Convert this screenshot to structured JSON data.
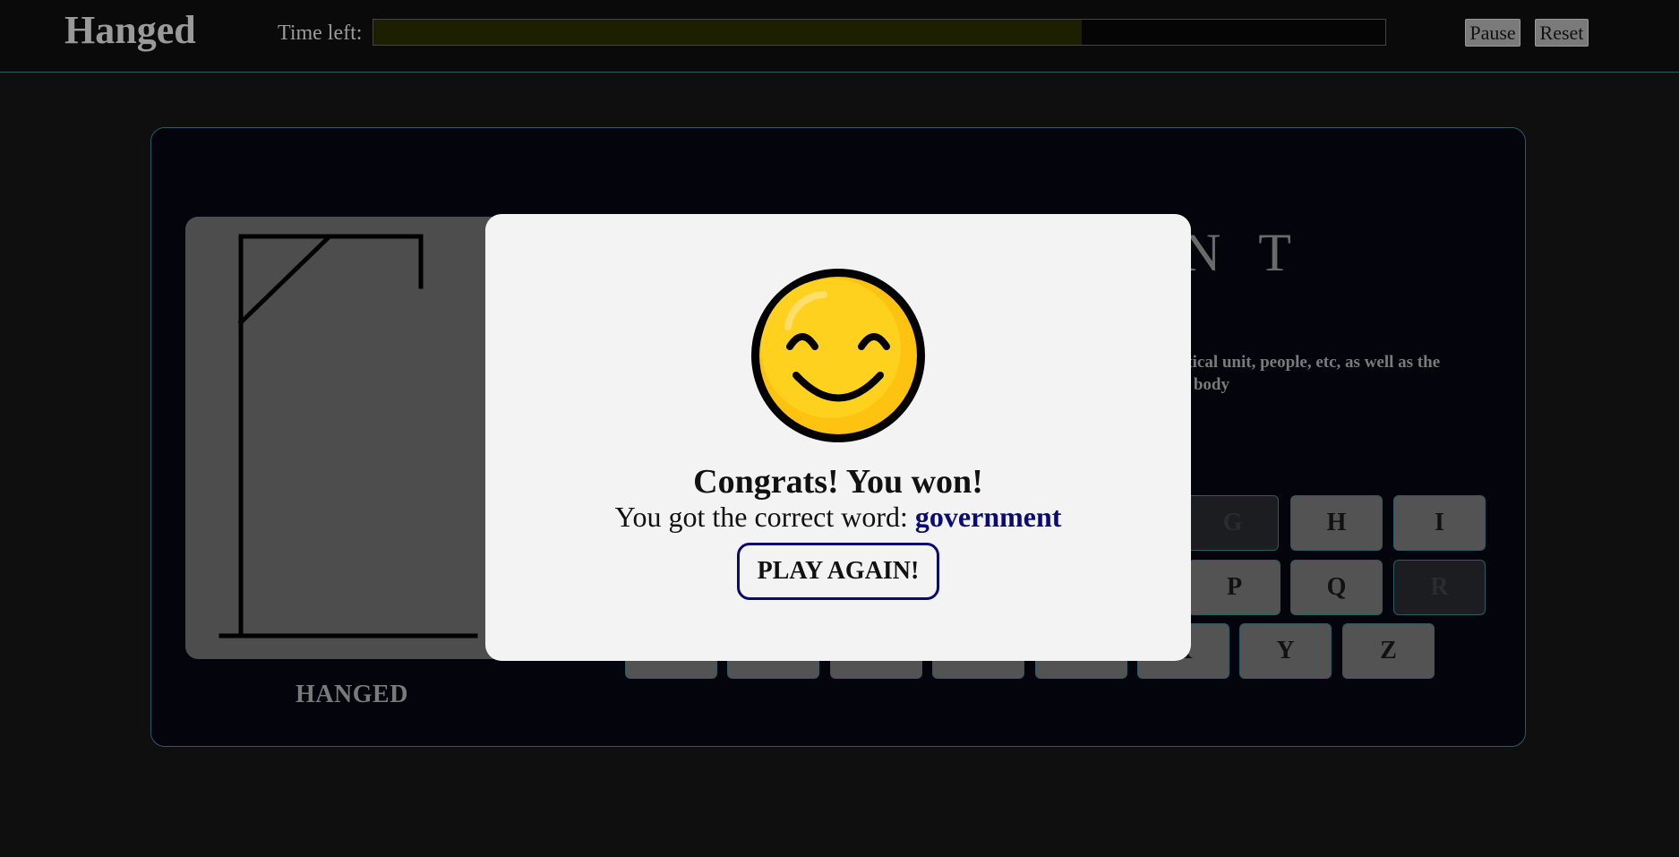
{
  "header": {
    "brand": "Hanged",
    "time_label": "Time left:",
    "time_left_fraction": 0.7,
    "pause_label": "Pause",
    "reset_label": "Reset"
  },
  "game": {
    "word_display": "N T",
    "hint": "itical unit, people, etc, as well as the r body",
    "hint_line1": "itical unit, people, etc, as well as the",
    "hint_line2": "r body",
    "hanged_label": "HANGED"
  },
  "keyboard": {
    "row1": [
      {
        "letter": "G",
        "used": true
      },
      {
        "letter": "H",
        "used": false
      },
      {
        "letter": "I",
        "used": false
      }
    ],
    "row2": [
      {
        "letter": "P",
        "used": false
      },
      {
        "letter": "Q",
        "used": false
      },
      {
        "letter": "R",
        "used": true
      }
    ],
    "row3": [
      {
        "letter": "",
        "used": false
      },
      {
        "letter": "",
        "used": false
      },
      {
        "letter": "",
        "used": false
      },
      {
        "letter": "",
        "used": false
      },
      {
        "letter": "",
        "used": false
      },
      {
        "letter": "X",
        "used": false
      },
      {
        "letter": "Y",
        "used": false
      },
      {
        "letter": "Z",
        "used": false
      }
    ]
  },
  "modal": {
    "icon": "smiley-face-icon",
    "title": "Congrats! You won!",
    "text_prefix": "You got the correct word: ",
    "word": "government",
    "play_again_label": "PLAY AGAIN!"
  },
  "colors": {
    "background": "#0f0f0f",
    "board": "#03040c",
    "accent_border": "#2e5a62",
    "modal_word": "#0b0b78",
    "smiley_yellow": "#fed11f"
  }
}
